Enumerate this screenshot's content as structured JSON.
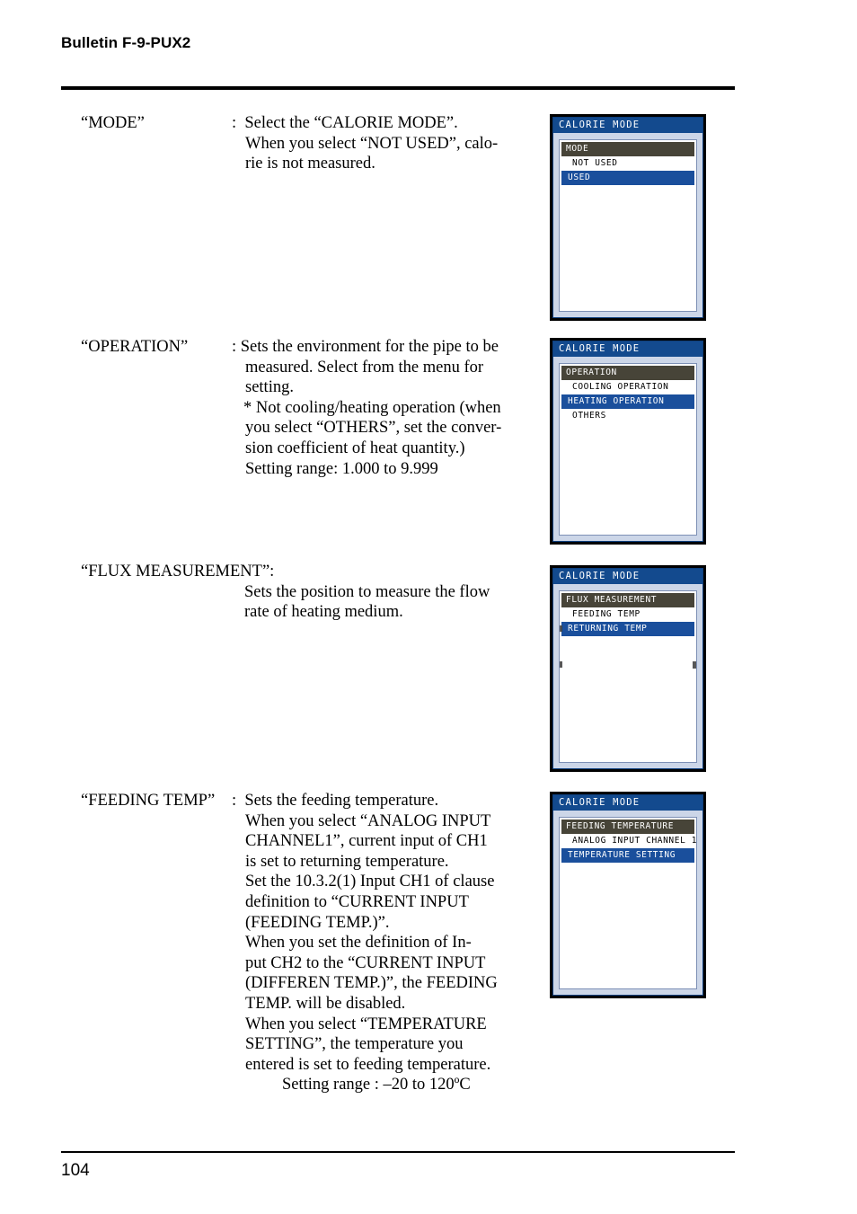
{
  "header": {
    "bulletin": "Bulletin F-9-PUX2"
  },
  "footer": {
    "page_number": "104"
  },
  "colors": {
    "lcd_titlebar": "#134a8e",
    "lcd_menu_header": "#474438",
    "lcd_selected": "#1a4f9c",
    "lcd_background": "#ccd6e8",
    "lcd_list_background": "#ffffff"
  },
  "entries": [
    {
      "term": "“MODE”",
      "colon": ":",
      "lines": [
        "Select the “CALORIE MODE”.",
        "When you select “NOT USED”, calo-",
        "rie is not measured."
      ]
    },
    {
      "term": "“OPERATION”",
      "colon": ":",
      "lines": [
        "Sets the environment for the pipe to be",
        "measured.  Select from the menu for",
        "setting.",
        "* Not cooling/heating operation (when",
        "you select “OTHERS”, set the conver-",
        "sion coefficient of heat quantity.)",
        "Setting range: 1.000 to 9.999"
      ]
    },
    {
      "term": "“FLUX MEASUREMENT”:",
      "colon": "",
      "lines": [
        "Sets the position to measure the flow",
        "rate of heating medium."
      ]
    },
    {
      "term": "“FEEDING TEMP”",
      "colon": ":",
      "lines": [
        "Sets the feeding temperature.",
        "When you select “ANALOG INPUT",
        "CHANNEL1”, current input of CH1",
        "is set to returning temperature.",
        "Set the 10.3.2(1) Input CH1 of clause",
        "definition to “CURRENT INPUT",
        "(FEEDING TEMP.)”.",
        "When you set the definition of In-",
        "put CH2 to the “CURRENT INPUT",
        "(DIFFEREN TEMP.)”, the FEEDING",
        "TEMP. will be disabled.",
        "When you select “TEMPERATURE",
        "SETTING”, the temperature you",
        "entered is set to feeding temperature.",
        "Setting range : –20 to 120ºC"
      ]
    }
  ],
  "screens": [
    {
      "title": "CALORIE MODE",
      "menu_header": "MODE",
      "items": [
        {
          "label": "NOT USED",
          "selected": false
        },
        {
          "label": "USED",
          "selected": true
        }
      ]
    },
    {
      "title": "CALORIE MODE",
      "menu_header": "OPERATION",
      "items": [
        {
          "label": "COOLING OPERATION",
          "selected": false
        },
        {
          "label": "HEATING OPERATION",
          "selected": true
        },
        {
          "label": "OTHERS",
          "selected": false
        }
      ]
    },
    {
      "title": "CALORIE MODE",
      "menu_header": "FLUX MEASUREMENT",
      "items": [
        {
          "label": "FEEDING TEMP",
          "selected": false
        },
        {
          "label": "RETURNING TEMP",
          "selected": true
        }
      ]
    },
    {
      "title": "CALORIE MODE",
      "menu_header": "FEEDING TEMPERATURE",
      "items": [
        {
          "label": "ANALOG INPUT CHANNEL 1",
          "selected": false
        },
        {
          "label": "TEMPERATURE SETTING",
          "selected": true
        }
      ]
    }
  ]
}
